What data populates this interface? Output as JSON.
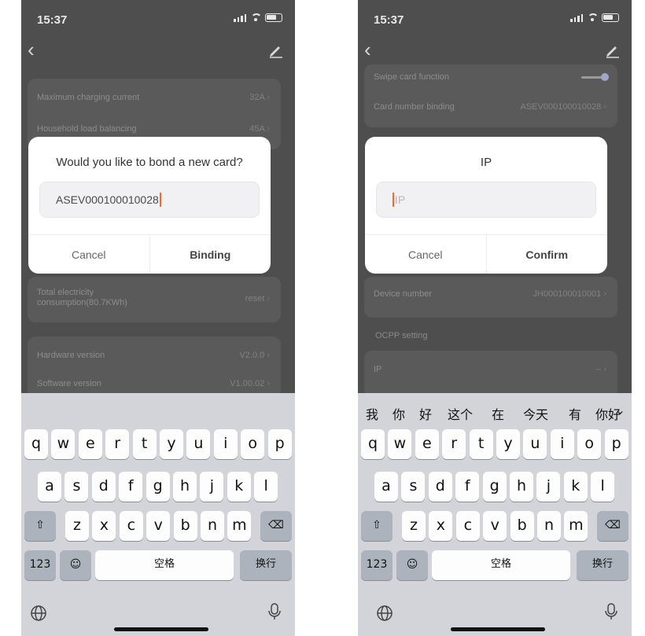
{
  "status": {
    "time": "15:37"
  },
  "left": {
    "rows": [
      {
        "label": "Maximum charging current",
        "value": "32A"
      },
      {
        "label": "Household load balancing",
        "value": "45A"
      },
      {
        "label": "Total electricity consumption(80.7KWh)",
        "value": "reset"
      },
      {
        "label": "Hardware version",
        "value": "V2.0.0"
      },
      {
        "label": "Software version",
        "value": "V1.00.02"
      }
    ],
    "dialog": {
      "title": "Would you like to bond a new card?",
      "input_value": "ASEV000100010028",
      "cancel_label": "Cancel",
      "ok_label": "Binding"
    }
  },
  "right": {
    "rows": [
      {
        "label": "Swipe card function"
      },
      {
        "label": "Card number binding",
        "value": "ASEV000100010028"
      },
      {
        "label": "Device number",
        "value": "JH000100010001"
      },
      {
        "label": "IP",
        "value": "--"
      }
    ],
    "section_ocpp": "OCPP setting",
    "dialog": {
      "title": "IP",
      "placeholder": "IP",
      "cancel_label": "Cancel",
      "ok_label": "Confirm"
    },
    "candidates": [
      "我",
      "你",
      "好",
      "这个",
      "在",
      "今天",
      "有",
      "你好"
    ]
  },
  "keyboard": {
    "row1": [
      "q",
      "w",
      "e",
      "r",
      "t",
      "y",
      "u",
      "i",
      "o",
      "p"
    ],
    "row2": [
      "a",
      "s",
      "d",
      "f",
      "g",
      "h",
      "j",
      "k",
      "l"
    ],
    "row3": [
      "z",
      "x",
      "c",
      "v",
      "b",
      "n",
      "m"
    ],
    "numbers_label": "123",
    "space_label": "空格",
    "return_label": "换行"
  },
  "colors": {
    "overlay": "#4e4e4e",
    "keyboard_bg": "#d3d4d9",
    "caret": "#f56a2a"
  }
}
